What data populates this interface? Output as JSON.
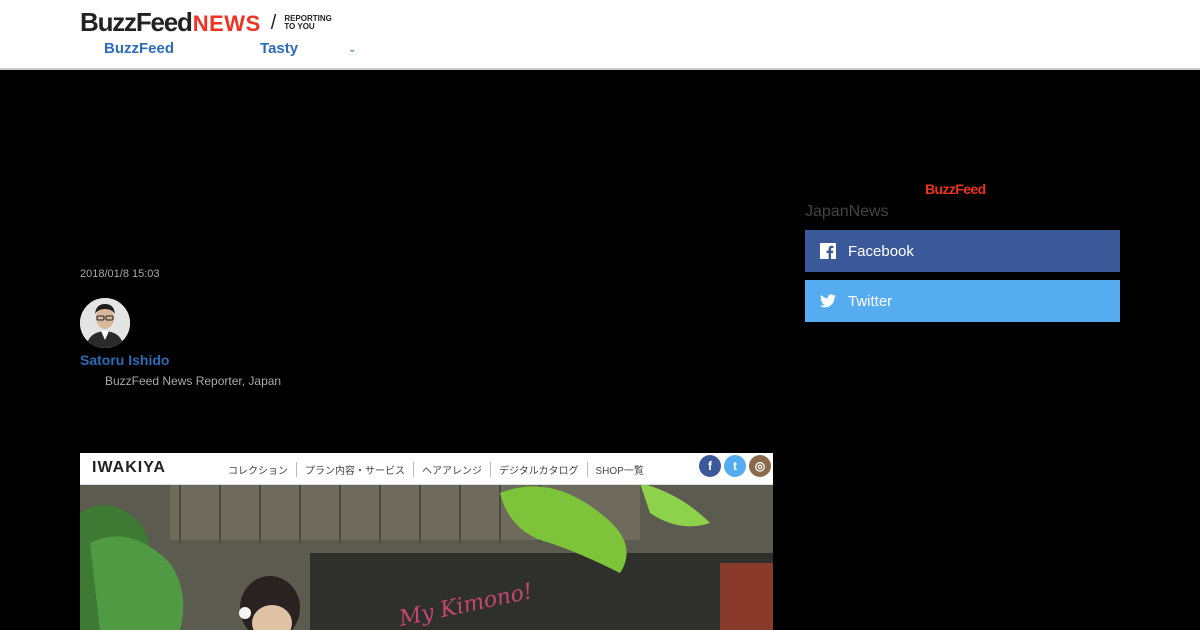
{
  "header": {
    "logo_primary": "BuzzFeed",
    "logo_secondary": "NEWS",
    "logo_tagline": "REPORTING TO YOU",
    "nav": [
      {
        "label": "BuzzFeed"
      },
      {
        "label": "Tasty"
      }
    ]
  },
  "article": {
    "timestamp": "2018/01/8 15:03",
    "author_name": "Satoru Ishido",
    "author_role": "BuzzFeed News Reporter, Japan"
  },
  "hero": {
    "brand": "IWAKIYA",
    "menu": [
      "コレクション",
      "プラン内容・サービス",
      "ヘアアレンジ",
      "デジタルカタログ",
      "SHOP一覧"
    ],
    "overlay_text": "My Kimono!"
  },
  "sidebar": {
    "logo": "BuzzFeed",
    "label": "JapanNews",
    "share": [
      {
        "label": "Facebook",
        "color": "#3b5998"
      },
      {
        "label": "Twitter",
        "color": "#55acee"
      }
    ]
  },
  "colors": {
    "link_blue": "#2c6bb8",
    "brand_red": "#e32"
  }
}
